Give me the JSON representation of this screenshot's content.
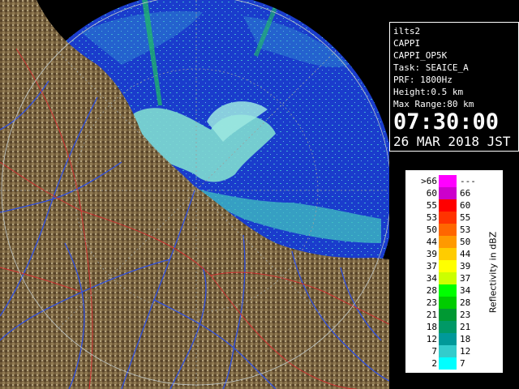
{
  "info": {
    "station": "ilts2",
    "product": "CAPPI",
    "product_id": "CAPPI_OP5K",
    "task": "Task: SEAICE_A",
    "prf": "PRF: 1800Hz",
    "height": "Height:0.5 km",
    "max_range": "Max Range:80 km",
    "time": "07:30:00",
    "date": "26 MAR 2018 JST"
  },
  "legend": {
    "units_label": "Reflectivity in dBZ",
    "rows": [
      {
        "lo": ">66",
        "hi": "---",
        "color": "#ff00ff"
      },
      {
        "lo": "60",
        "hi": "66",
        "color": "#cc00cc"
      },
      {
        "lo": "55",
        "hi": "60",
        "color": "#ff0000"
      },
      {
        "lo": "53",
        "hi": "55",
        "color": "#ff3300"
      },
      {
        "lo": "50",
        "hi": "53",
        "color": "#ff6600"
      },
      {
        "lo": "44",
        "hi": "50",
        "color": "#ff9900"
      },
      {
        "lo": "39",
        "hi": "44",
        "color": "#ffcc00"
      },
      {
        "lo": "37",
        "hi": "39",
        "color": "#ffff00"
      },
      {
        "lo": "34",
        "hi": "37",
        "color": "#ccff00"
      },
      {
        "lo": "28",
        "hi": "34",
        "color": "#00ff00"
      },
      {
        "lo": "23",
        "hi": "28",
        "color": "#00cc00"
      },
      {
        "lo": "21",
        "hi": "23",
        "color": "#009933"
      },
      {
        "lo": "18",
        "hi": "21",
        "color": "#009966"
      },
      {
        "lo": "12",
        "hi": "18",
        "color": "#009999"
      },
      {
        "lo": "7",
        "hi": "12",
        "color": "#33cccc"
      },
      {
        "lo": "2",
        "hi": "7",
        "color": "#00ffff"
      }
    ]
  },
  "colors": {
    "sea": "#1a3ccc",
    "echo_light": "#7fdcd0",
    "echo_mid": "#40c0c0",
    "land": "#7a6440",
    "river": "#3050e0",
    "boundary": "#d03030"
  }
}
